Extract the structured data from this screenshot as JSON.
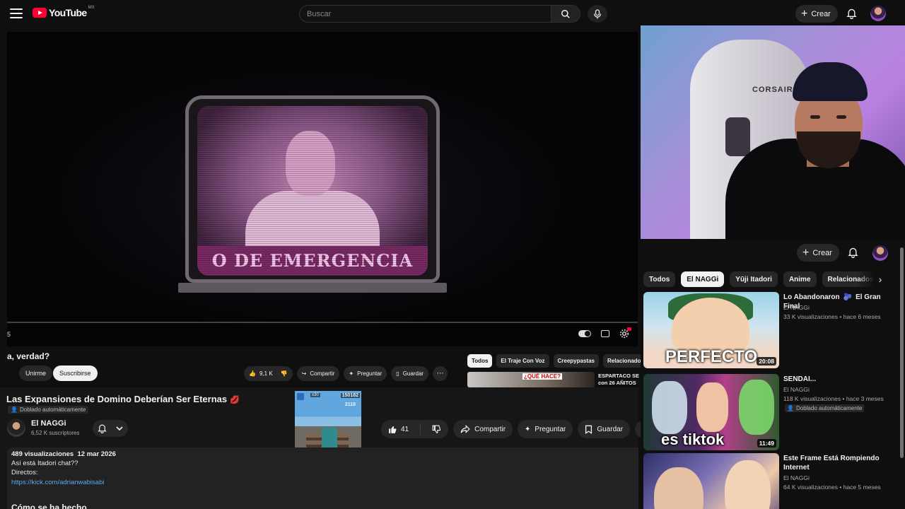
{
  "header": {
    "logo_text": "YouTube",
    "region": "MX",
    "search_placeholder": "Buscar",
    "create_label": "Crear"
  },
  "player": {
    "time": "5",
    "tv_banner_text": "O DE EMERGENCIA"
  },
  "inner_page": {
    "title_fragment": "a, verdad?",
    "join_label": "Unirme",
    "subscribe_label": "Suscribirse",
    "like_count": "9,1 K",
    "share_label": "Compartir",
    "ask_label": "Preguntar",
    "save_label": "Guardar",
    "chips": [
      "Todos",
      "El Traje Con Voz",
      "Creepypastas",
      "Relacionados"
    ],
    "thumb_label": "¿QUÉ HACE?",
    "rec_title": "ESPARTACO SE con 26 AÑITOS"
  },
  "video": {
    "title": "Las Expansiones de Domino Deberían Ser Eternas",
    "title_emoji": "💋",
    "dub_badge": "Doblado automáticamente",
    "channel_name": "El NAGGi",
    "subscribers": "6,52 K suscriptores",
    "like_count": "41",
    "share_label": "Compartir",
    "ask_label": "Preguntar",
    "save_label": "Guardar",
    "views": "489 visualizaciones",
    "date": "12 mar 2026",
    "desc_line1": "Así está Itadori chat??",
    "desc_line2": "Directos:",
    "desc_link": "https://kick.com/adrianwabisabi",
    "desc_heading": "Cómo se ha hecho"
  },
  "game_overlay": {
    "score": "150182",
    "coins": "2118",
    "multiplier": "x30"
  },
  "webcam": {
    "chair_brand": "CORSAIR"
  },
  "sidebar": {
    "create_label": "Crear",
    "chips": [
      "Todos",
      "El NAGGi",
      "Yūji Itadori",
      "Anime",
      "Relacionados"
    ],
    "active_chip": "El NAGGi",
    "recommendations": [
      {
        "title": "Lo Abandonaron 🫐 El Gran Final",
        "channel": "El NAGGi",
        "views": "33 K visualizaciones",
        "age": "hace 6 meses",
        "duration": "20:08",
        "thumb_word": "PERFECTO",
        "badge": ""
      },
      {
        "title": "SENDAI...",
        "channel": "El NAGGi",
        "views": "118 K visualizaciones",
        "age": "hace 3 meses",
        "duration": "11:49",
        "thumb_word": "es tiktok",
        "badge": "Doblado automáticamente"
      },
      {
        "title": "Este Frame Está Rompiendo Internet",
        "channel": "El NAGGi",
        "views": "64 K visualizaciones",
        "age": "hace 5 meses",
        "duration": "",
        "thumb_word": "",
        "badge": ""
      }
    ]
  },
  "colors": {
    "background": "#0f0f0f",
    "surface": "#272727",
    "accent_red": "#ff0033",
    "link_blue": "#5ea8f0"
  }
}
